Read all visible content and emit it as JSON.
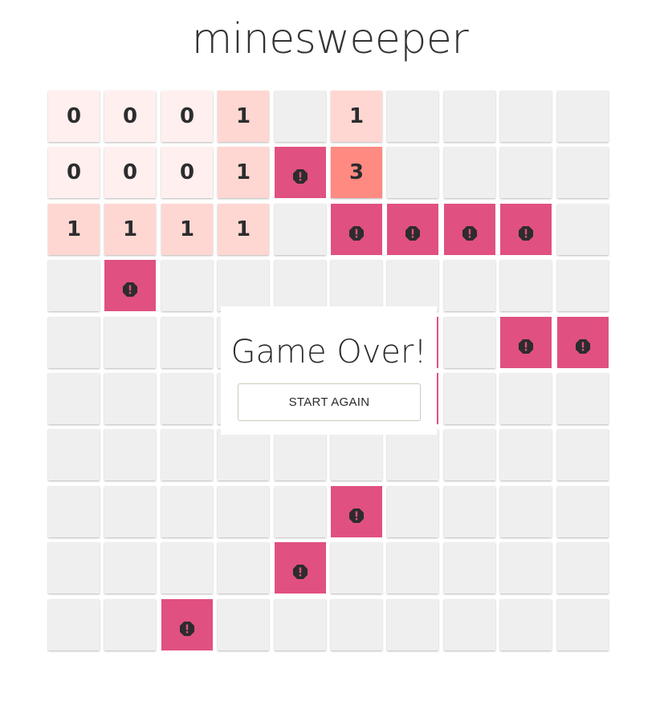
{
  "app": {
    "title": "minesweeper"
  },
  "colors": {
    "hidden": "#efefef",
    "mine": "#e05080",
    "n0": "#fff0ef",
    "n1": "#ffd7d2",
    "n3": "#ff8a82",
    "text": "#2c2c2e"
  },
  "board": {
    "rows": 10,
    "cols": 10,
    "legend": "H = hidden, M = mine (revealed), digits = revealed neighbor count",
    "cells": [
      [
        "0",
        "0",
        "0",
        "1",
        "H",
        "1",
        "H",
        "H",
        "H",
        "H"
      ],
      [
        "0",
        "0",
        "0",
        "1",
        "M",
        "3",
        "H",
        "H",
        "H",
        "H"
      ],
      [
        "1",
        "1",
        "1",
        "1",
        "H",
        "M",
        "M",
        "M",
        "M",
        "H"
      ],
      [
        "H",
        "M",
        "H",
        "H",
        "H",
        "H",
        "H",
        "H",
        "H",
        "H"
      ],
      [
        "H",
        "H",
        "H",
        "H",
        "H",
        "H",
        "M",
        "H",
        "M",
        "M"
      ],
      [
        "H",
        "H",
        "H",
        "H",
        "H",
        "H",
        "M",
        "H",
        "H",
        "H"
      ],
      [
        "H",
        "H",
        "H",
        "H",
        "H",
        "H",
        "H",
        "H",
        "H",
        "H"
      ],
      [
        "H",
        "H",
        "H",
        "H",
        "H",
        "M",
        "H",
        "H",
        "H",
        "H"
      ],
      [
        "H",
        "H",
        "H",
        "H",
        "M",
        "H",
        "H",
        "H",
        "H",
        "H"
      ],
      [
        "H",
        "H",
        "M",
        "H",
        "H",
        "H",
        "H",
        "H",
        "H",
        "H"
      ]
    ],
    "mine_icon": "octagon-exclamation-icon"
  },
  "modal": {
    "title": "Game Over!",
    "button_label": "START AGAIN"
  }
}
